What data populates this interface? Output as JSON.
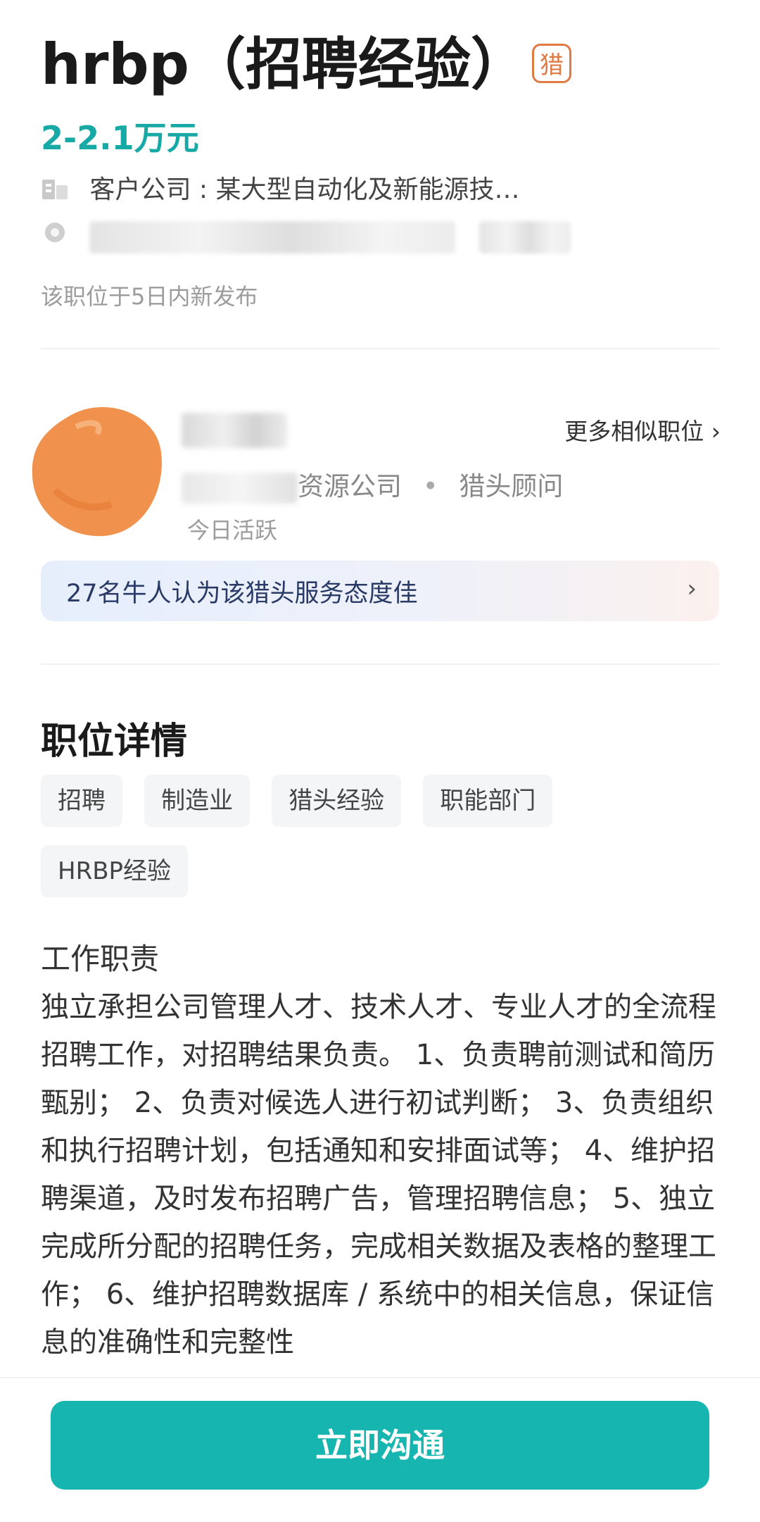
{
  "job": {
    "title": "hrbp（招聘经验）",
    "hunter_badge": "猎",
    "salary": "2-2.1万元",
    "company_label": "客户公司 : 某大型自动化及新能源技…",
    "posted": "该职位于5日内新发布"
  },
  "recruiter": {
    "more_similar": "更多相似职位",
    "company_suffix": "资源公司",
    "separator": "•",
    "role": "猎头顾问",
    "status": "今日活跃",
    "service_praise": "27名牛人认为该猎头服务态度佳"
  },
  "details": {
    "section_title": "职位详情",
    "tags": [
      "招聘",
      "制造业",
      "猎头经验",
      "职能部门",
      "HRBP经验"
    ],
    "responsibilities_title": "工作职责",
    "responsibilities_text": "独立承担公司管理人才、技术人才、专业人才的全流程招聘工作，对招聘结果负责。 1、负责聘前测试和简历甄别； 2、负责对候选人进行初试判断； 3、负责组织和执行招聘计划，包括通知和安排面试等； 4、维护招聘渠道，及时发布招聘广告，管理招聘信息； 5、独立完成所分配的招聘任务，完成相关数据及表格的整理工作； 6、维护招聘数据库 / 系统中的相关信息，保证信息的准确性和完整性"
  },
  "actions": {
    "chat_now": "立即沟通"
  },
  "colors": {
    "accent": "#17b5b0",
    "salary": "#17a9a6",
    "hunter_badge": "#e07a44"
  },
  "icons": {
    "company": "building-icon",
    "location": "location-pin-icon",
    "more": "chevron-right-icon"
  }
}
